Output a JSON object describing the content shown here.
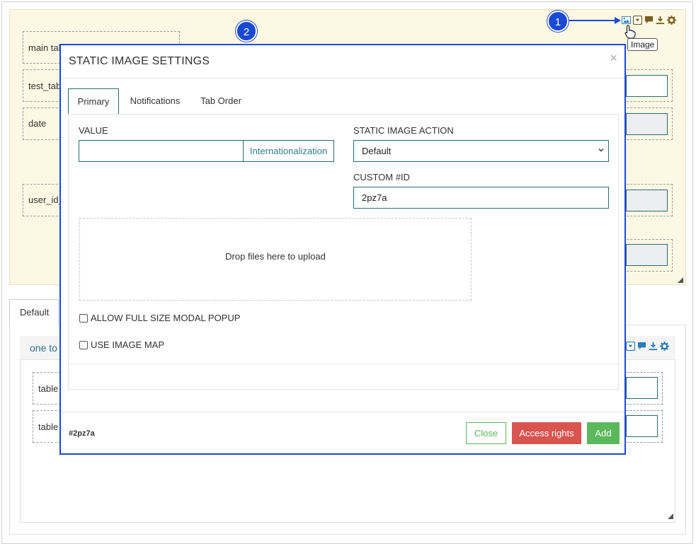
{
  "background": {
    "fields": [
      {
        "label": "main tal"
      },
      {
        "label": "test_tab"
      },
      {
        "label": "date"
      },
      {
        "label": "user_id_"
      }
    ],
    "tooltip": "Image",
    "tab_default": "Default",
    "inner_title": "one to",
    "inner_rows": [
      {
        "label": "table"
      },
      {
        "label": "table"
      }
    ],
    "toolbar_icons": [
      "image-icon",
      "dropdown-icon",
      "comment-icon",
      "download-icon",
      "gear-icon"
    ]
  },
  "annotations": {
    "step1": "1",
    "step2": "2",
    "color": "#1a49d6"
  },
  "modal": {
    "title": "STATIC IMAGE SETTINGS",
    "close": "×",
    "tabs": [
      {
        "label": "Primary",
        "active": true
      },
      {
        "label": "Notifications",
        "active": false
      },
      {
        "label": "Tab Order",
        "active": false
      }
    ],
    "value_label": "VALUE",
    "value_input": "",
    "i18n_button": "Internationalization",
    "action_label": "STATIC IMAGE ACTION",
    "action_selected": "Default",
    "custom_id_label": "CUSTOM #ID",
    "custom_id_value": "2pz7a",
    "dropzone_text": "Drop files here to upload",
    "checkbox_fullsize": "ALLOW FULL SIZE MODAL POPUP",
    "checkbox_imagemap": "USE IMAGE MAP",
    "footer_id": "#2pz7a",
    "buttons": {
      "close": "Close",
      "access_rights": "Access rights",
      "add": "Add"
    }
  },
  "colors": {
    "accent": "#2a6a75",
    "danger": "#d9534f",
    "success": "#5cb85c",
    "panel_bg": "#fcf8e3"
  }
}
